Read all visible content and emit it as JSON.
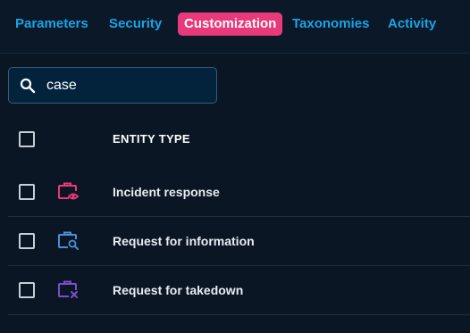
{
  "tabs": [
    {
      "label": "Parameters"
    },
    {
      "label": "Security"
    },
    {
      "label": "Customization"
    },
    {
      "label": "Taxonomies"
    },
    {
      "label": "Activity"
    }
  ],
  "active_tab": "Customization",
  "search": {
    "value": "case",
    "icon": "search-icon"
  },
  "table": {
    "column_header": "ENTITY TYPE",
    "rows": [
      {
        "label": "Incident response",
        "icon": "case-incident-icon",
        "icon_color": "#e8397a"
      },
      {
        "label": "Request for information",
        "icon": "case-rfi-icon",
        "icon_color": "#4a8fd4"
      },
      {
        "label": "Request for takedown",
        "icon": "case-rft-icon",
        "icon_color": "#7b4fc9"
      }
    ]
  },
  "colors": {
    "accent": "#e8397a",
    "tab_text": "#1ba3e6",
    "background": "#0a1624"
  }
}
